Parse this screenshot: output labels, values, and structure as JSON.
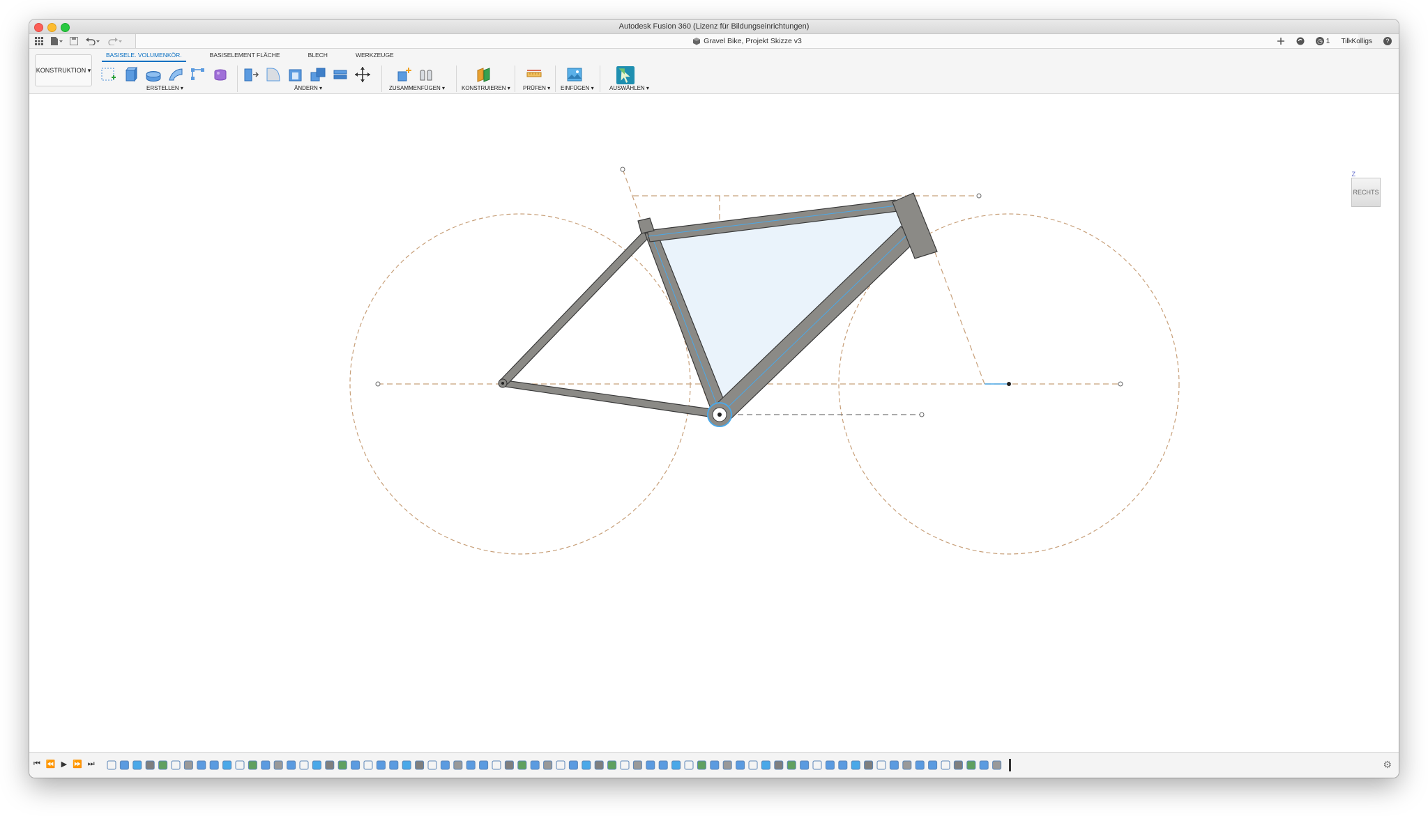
{
  "window": {
    "title": "Autodesk Fusion 360 (Lizenz für Bildungseinrichtungen)"
  },
  "appbar": {
    "document_title": "Gravel Bike, Projekt Skizze v3",
    "job_count": "1",
    "user": "Till Kolligs",
    "help": "?"
  },
  "ribbon": {
    "workspace": "KONSTRUKTION",
    "tabs": [
      "BASISELE. VOLUMENKÖR.",
      "BASISELEMENT FLÄCHE",
      "BLECH",
      "WERKZEUGE"
    ],
    "groups": {
      "create": "ERSTELLEN",
      "modify": "ÄNDERN",
      "assemble": "ZUSAMMENFÜGEN",
      "construct": "KONSTRUIEREN",
      "inspect": "PRÜFEN",
      "insert": "EINFÜGEN",
      "select": "AUSWÄHLEN"
    }
  },
  "viewcube": {
    "face": "RECHTS",
    "axis": "Z"
  },
  "colors": {
    "accent": "#0a70c2",
    "tube_fill": "#8b8a86",
    "tube_edge": "#3a3a3a",
    "construction": "#c8a07a",
    "highlight": "#4aa8e8",
    "profile_fill": "#eaf3fb"
  },
  "icons": {
    "grid": "grid-icon",
    "file": "file-icon",
    "save": "save-icon",
    "undo": "undo-icon",
    "redo": "redo-icon",
    "settings": "gear-icon"
  }
}
